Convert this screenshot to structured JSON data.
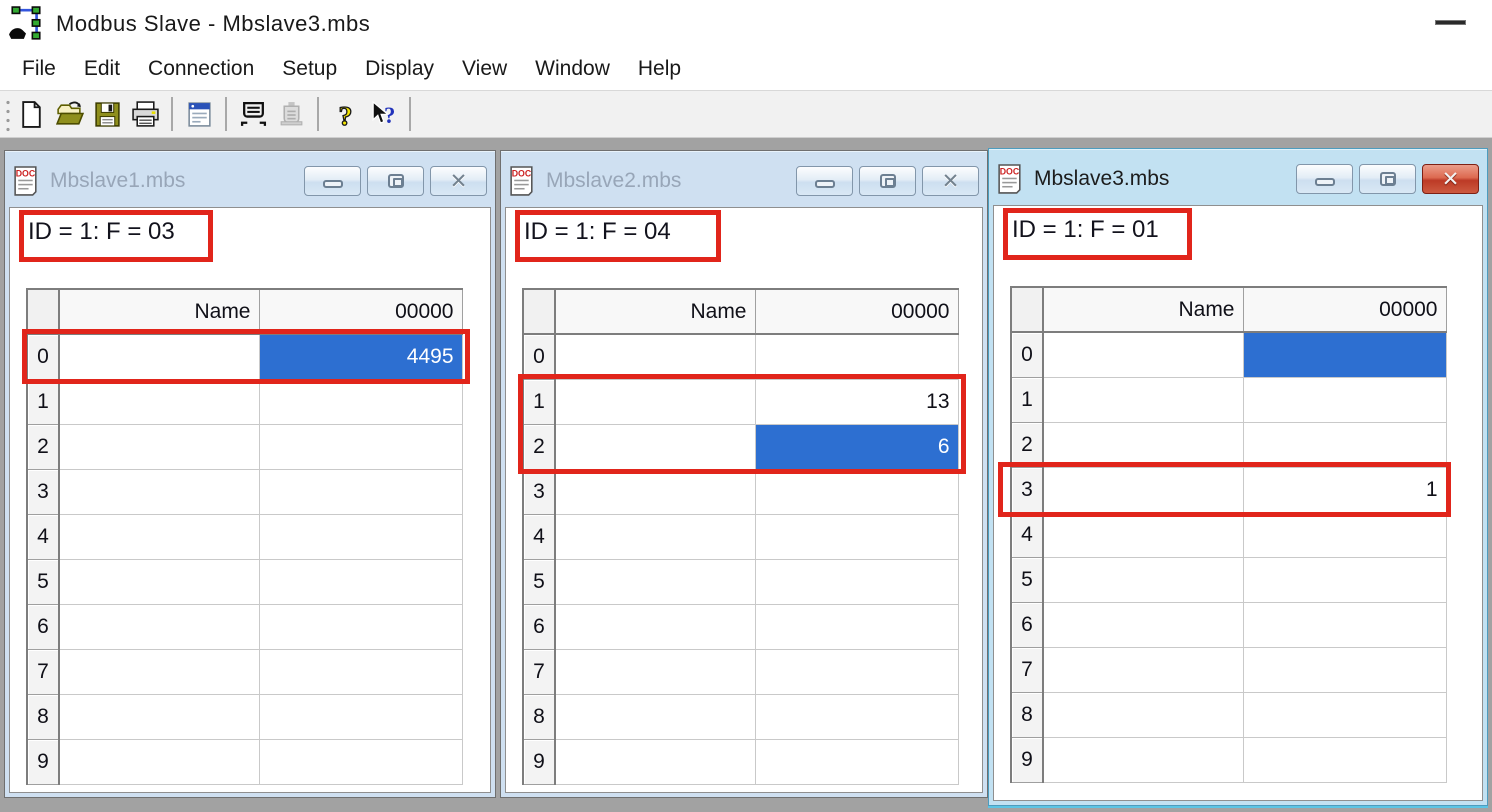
{
  "app": {
    "title": "Modbus Slave - Mbslave3.mbs"
  },
  "menu": {
    "items": [
      "File",
      "Edit",
      "Connection",
      "Setup",
      "Display",
      "View",
      "Window",
      "Help"
    ]
  },
  "toolbar": {
    "buttons": [
      {
        "icon": "new-file-icon",
        "enabled": true
      },
      {
        "icon": "open-file-icon",
        "enabled": true
      },
      {
        "icon": "save-file-icon",
        "enabled": true
      },
      {
        "icon": "print-icon",
        "enabled": true
      },
      {
        "icon": "display-setup-icon",
        "enabled": true
      },
      {
        "icon": "poll-definition-icon",
        "enabled": true
      },
      {
        "icon": "communication-icon",
        "enabled": false
      },
      {
        "icon": "help-icon",
        "enabled": true
      },
      {
        "icon": "context-help-icon",
        "enabled": true
      }
    ]
  },
  "windows": [
    {
      "title": "Mbslave1.mbs",
      "active": false,
      "status_line": "ID = 1: F = 03",
      "columns": {
        "row": "",
        "name": "Name",
        "value": "00000"
      },
      "rows": [
        {
          "n": "0",
          "name": "",
          "value": "4495",
          "selected": true
        },
        {
          "n": "1",
          "name": "",
          "value": "",
          "selected": false
        },
        {
          "n": "2",
          "name": "",
          "value": "",
          "selected": false
        },
        {
          "n": "3",
          "name": "",
          "value": "",
          "selected": false
        },
        {
          "n": "4",
          "name": "",
          "value": "",
          "selected": false
        },
        {
          "n": "5",
          "name": "",
          "value": "",
          "selected": false
        },
        {
          "n": "6",
          "name": "",
          "value": "",
          "selected": false
        },
        {
          "n": "7",
          "name": "",
          "value": "",
          "selected": false
        },
        {
          "n": "8",
          "name": "",
          "value": "",
          "selected": false
        },
        {
          "n": "9",
          "name": "",
          "value": "",
          "selected": false
        }
      ],
      "annotations": {
        "status_line_boxed": true,
        "boxed_rows": [
          0,
          0
        ]
      }
    },
    {
      "title": "Mbslave2.mbs",
      "active": false,
      "status_line": "ID = 1: F = 04",
      "columns": {
        "row": "",
        "name": "Name",
        "value": "00000"
      },
      "rows": [
        {
          "n": "0",
          "name": "",
          "value": "",
          "selected": false
        },
        {
          "n": "1",
          "name": "",
          "value": "13",
          "selected": false
        },
        {
          "n": "2",
          "name": "",
          "value": "6",
          "selected": true
        },
        {
          "n": "3",
          "name": "",
          "value": "",
          "selected": false
        },
        {
          "n": "4",
          "name": "",
          "value": "",
          "selected": false
        },
        {
          "n": "5",
          "name": "",
          "value": "",
          "selected": false
        },
        {
          "n": "6",
          "name": "",
          "value": "",
          "selected": false
        },
        {
          "n": "7",
          "name": "",
          "value": "",
          "selected": false
        },
        {
          "n": "8",
          "name": "",
          "value": "",
          "selected": false
        },
        {
          "n": "9",
          "name": "",
          "value": "",
          "selected": false
        }
      ],
      "annotations": {
        "status_line_boxed": true,
        "boxed_rows": [
          1,
          2
        ]
      }
    },
    {
      "title": "Mbslave3.mbs",
      "active": true,
      "status_line": "ID = 1: F = 01",
      "columns": {
        "row": "",
        "name": "Name",
        "value": "00000"
      },
      "rows": [
        {
          "n": "0",
          "name": "",
          "value": "",
          "selected": true
        },
        {
          "n": "1",
          "name": "",
          "value": "",
          "selected": false
        },
        {
          "n": "2",
          "name": "",
          "value": "",
          "selected": false
        },
        {
          "n": "3",
          "name": "",
          "value": "1",
          "selected": false
        },
        {
          "n": "4",
          "name": "",
          "value": "",
          "selected": false
        },
        {
          "n": "5",
          "name": "",
          "value": "",
          "selected": false
        },
        {
          "n": "6",
          "name": "",
          "value": "",
          "selected": false
        },
        {
          "n": "7",
          "name": "",
          "value": "",
          "selected": false
        },
        {
          "n": "8",
          "name": "",
          "value": "",
          "selected": false
        },
        {
          "n": "9",
          "name": "",
          "value": "",
          "selected": false
        }
      ],
      "annotations": {
        "status_line_boxed": true,
        "boxed_rows": [
          3,
          3
        ]
      }
    }
  ]
}
